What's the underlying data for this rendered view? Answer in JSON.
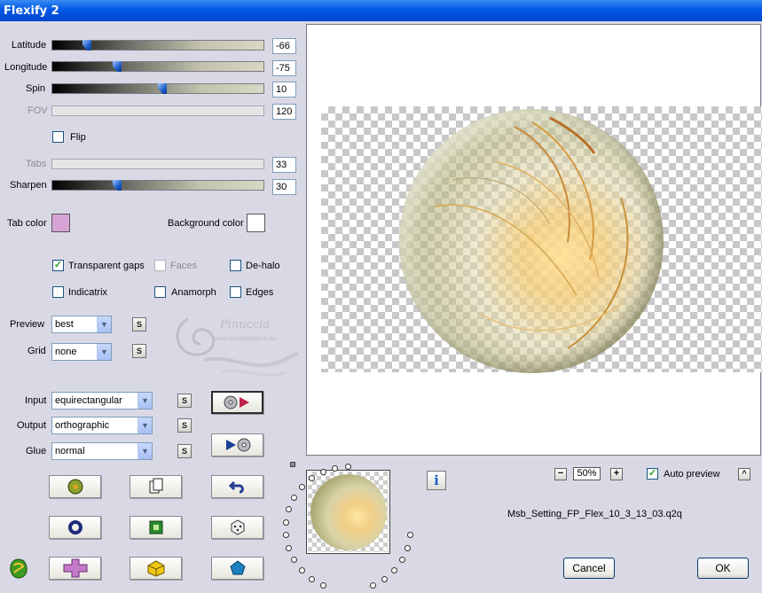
{
  "window": {
    "title": "Flexify 2"
  },
  "sliders": {
    "latitude": {
      "label": "Latitude",
      "value": "-66",
      "level": 0.15
    },
    "longitude": {
      "label": "Longitude",
      "value": "-75",
      "level": 0.3
    },
    "spin": {
      "label": "Spin",
      "value": "10",
      "level": 0.52
    },
    "fov": {
      "label": "FOV",
      "value": "120",
      "disabled": true
    },
    "tabs": {
      "label": "Tabs",
      "value": "33",
      "disabled": true
    },
    "sharpen": {
      "label": "Sharpen",
      "value": "30",
      "level": 0.3
    }
  },
  "flip": {
    "label": "Flip",
    "checked": false
  },
  "colors": {
    "tab_color_label": "Tab color",
    "tab_color": "#d8a4d6",
    "background_color_label": "Background color",
    "background_color": "#ffffff"
  },
  "options": {
    "transparent_gaps": {
      "label": "Transparent gaps",
      "checked": true
    },
    "faces": {
      "label": "Faces",
      "checked": false,
      "disabled": true
    },
    "de_halo": {
      "label": "De-halo",
      "checked": false
    },
    "indicatrix": {
      "label": "Indicatrix",
      "checked": false
    },
    "anamorph": {
      "label": "Anamorph",
      "checked": false
    },
    "edges": {
      "label": "Edges",
      "checked": false
    }
  },
  "selects": {
    "preview": {
      "label": "Preview",
      "value": "best"
    },
    "grid": {
      "label": "Grid",
      "value": "none"
    },
    "input": {
      "label": "Input",
      "value": "equirectangular"
    },
    "output": {
      "label": "Output",
      "value": "orthographic"
    },
    "glue": {
      "label": "Glue",
      "value": "normal"
    }
  },
  "small_button_label": "S",
  "zoom": {
    "minus": "−",
    "value": "50%",
    "plus": "+"
  },
  "auto_preview": {
    "label": "Auto preview",
    "checked": true,
    "toggle": "^"
  },
  "info_label": "i",
  "filename": "Msb_Setting_FP_Flex_10_3_13_03.q2q",
  "buttons": {
    "cancel": "Cancel",
    "ok": "OK"
  },
  "watermark": {
    "name": "Pinuccia",
    "url": "www.moldiargrafica.eu"
  },
  "accent": "#0058e6"
}
